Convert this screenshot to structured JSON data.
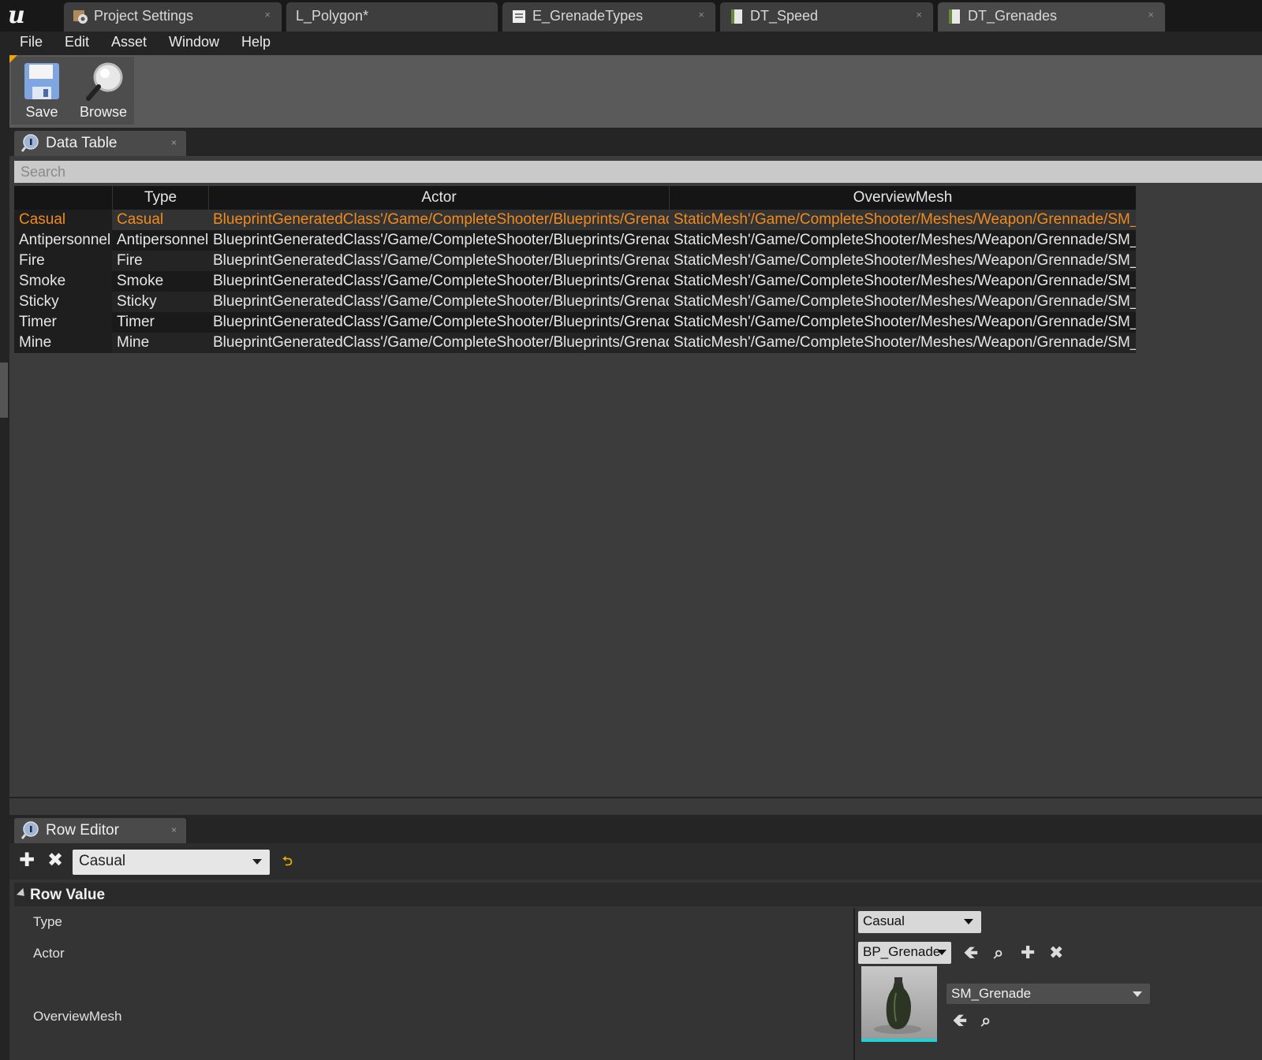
{
  "tabs": [
    {
      "label": "Project Settings",
      "icon": "settings-gear-icon",
      "close": "×"
    },
    {
      "label": "L_Polygon*",
      "icon": "",
      "close": ""
    },
    {
      "label": "E_GrenadeTypes",
      "icon": "enum-asset-icon",
      "close": "×"
    },
    {
      "label": "DT_Speed",
      "icon": "datatable-asset-icon",
      "close": "×"
    },
    {
      "label": "DT_Grenades",
      "icon": "datatable-asset-icon",
      "close": "×"
    }
  ],
  "logo": "u",
  "menu": [
    "File",
    "Edit",
    "Asset",
    "Window",
    "Help"
  ],
  "toolbar": {
    "save_label": "Save",
    "browse_label": "Browse"
  },
  "data_table_tab": {
    "label": "Data Table",
    "close": "×"
  },
  "search": {
    "placeholder": "Search",
    "value": ""
  },
  "table": {
    "columns": [
      "",
      "Type",
      "Actor",
      "OverviewMesh"
    ],
    "rows": [
      {
        "name": "Casual",
        "type": "Casual",
        "actor": "BlueprintGeneratedClass'/Game/CompleteShooter/Blueprints/Grenades/",
        "mesh": "StaticMesh'/Game/CompleteShooter/Meshes/Weapon/Grennade/SM_Gr"
      },
      {
        "name": "Antipersonnel",
        "type": "Antipersonnel",
        "actor": "BlueprintGeneratedClass'/Game/CompleteShooter/Blueprints/Grenades/",
        "mesh": "StaticMesh'/Game/CompleteShooter/Meshes/Weapon/Grennade/SM_Gr"
      },
      {
        "name": "Fire",
        "type": "Fire",
        "actor": "BlueprintGeneratedClass'/Game/CompleteShooter/Blueprints/Grenades/",
        "mesh": "StaticMesh'/Game/CompleteShooter/Meshes/Weapon/Grennade/SM_Gr"
      },
      {
        "name": "Smoke",
        "type": "Smoke",
        "actor": "BlueprintGeneratedClass'/Game/CompleteShooter/Blueprints/Grenades/",
        "mesh": "StaticMesh'/Game/CompleteShooter/Meshes/Weapon/Grennade/SM_Gr"
      },
      {
        "name": "Sticky",
        "type": "Sticky",
        "actor": "BlueprintGeneratedClass'/Game/CompleteShooter/Blueprints/Grenades/",
        "mesh": "StaticMesh'/Game/CompleteShooter/Meshes/Weapon/Grennade/SM_Gr"
      },
      {
        "name": "Timer",
        "type": "Timer",
        "actor": "BlueprintGeneratedClass'/Game/CompleteShooter/Blueprints/Grenades/",
        "mesh": "StaticMesh'/Game/CompleteShooter/Meshes/Weapon/Grennade/SM_Gr"
      },
      {
        "name": "Mine",
        "type": "Mine",
        "actor": "BlueprintGeneratedClass'/Game/CompleteShooter/Blueprints/Grenades/",
        "mesh": "StaticMesh'/Game/CompleteShooter/Meshes/Weapon/Grennade/SM_Gr"
      }
    ],
    "selected_index": 0
  },
  "row_editor": {
    "tab_label": "Row Editor",
    "close": "×",
    "add_glyph": "✚",
    "remove_glyph": "✖",
    "reset_glyph": "⮌",
    "selected_row": "Casual",
    "section_title": "Row Value",
    "properties": {
      "type_label": "Type",
      "type_value": "Casual",
      "actor_label": "Actor",
      "actor_value": "BP_Grenade",
      "mesh_label": "OverviewMesh",
      "mesh_value": "SM_Grenade"
    },
    "actor_glyphs": {
      "use": "🡸",
      "browse": "⌕",
      "add": "✚",
      "clear": "✖"
    },
    "mesh_glyphs": {
      "use": "🡸",
      "browse": "⌕"
    }
  },
  "colors": {
    "selected_text": "#f28a1c",
    "toolbar_accent": "#f0a500",
    "thumb_underline": "#1fd0d8"
  }
}
